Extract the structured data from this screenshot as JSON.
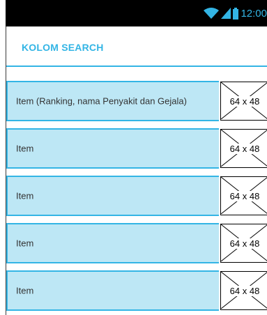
{
  "status_bar": {
    "time": "12:00",
    "icons": [
      "wifi-icon",
      "signal-icon",
      "battery-icon"
    ],
    "accent_color": "#33b5e5"
  },
  "action_bar": {
    "title": "KOLOM SEARCH"
  },
  "list": {
    "items": [
      {
        "label": "Item (Ranking, nama Penyakit dan Gejala)",
        "thumbnail": "64 x 48"
      },
      {
        "label": "Item",
        "thumbnail": "64 x 48"
      },
      {
        "label": "Item",
        "thumbnail": "64 x 48"
      },
      {
        "label": "Item",
        "thumbnail": "64 x 48"
      },
      {
        "label": "Item",
        "thumbnail": "64 x 48"
      }
    ]
  },
  "colors": {
    "accent": "#33b5e5",
    "item_background": "#bde7f5",
    "status_bar_background": "#000000"
  }
}
